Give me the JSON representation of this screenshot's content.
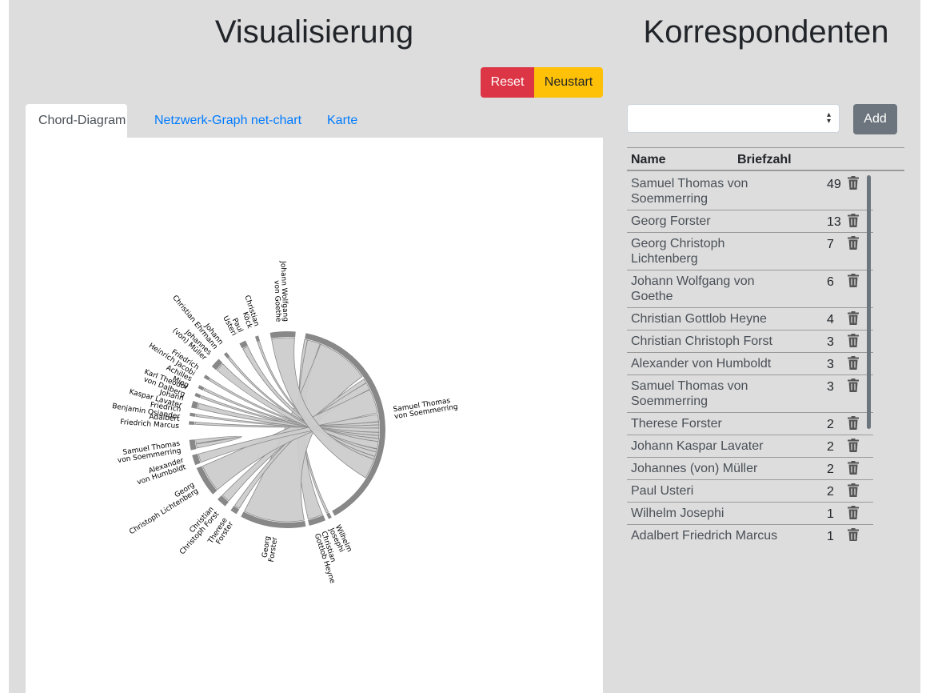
{
  "left_title": "Visualisierung",
  "right_title": "Korrespondenten",
  "buttons": {
    "reset": "Reset",
    "restart": "Neustart",
    "add": "Add"
  },
  "tabs": [
    "Chord-Diagram",
    "Netzwerk-Graph net-chart",
    "Karte"
  ],
  "select": {
    "value": ""
  },
  "table": {
    "headers": {
      "name": "Name",
      "count": "Briefzahl"
    },
    "rows": [
      {
        "name": "Samuel Thomas von Soemmerring",
        "count": "49"
      },
      {
        "name": "Georg Forster",
        "count": "13"
      },
      {
        "name": "Georg Christoph Lichtenberg",
        "count": "7"
      },
      {
        "name": "Johann Wolfgang von Goethe",
        "count": "6"
      },
      {
        "name": "Christian Gottlob Heyne",
        "count": "4"
      },
      {
        "name": "Christian Christoph Forst",
        "count": "3"
      },
      {
        "name": "Alexander von Humboldt",
        "count": "3"
      },
      {
        "name": "Samuel Thomas von Soemmerring",
        "count": "3"
      },
      {
        "name": "Therese Forster",
        "count": "2"
      },
      {
        "name": "Johann Kaspar Lavater",
        "count": "2"
      },
      {
        "name": "Johannes (von) Müller",
        "count": "2"
      },
      {
        "name": "Paul Usteri",
        "count": "2"
      },
      {
        "name": "Wilhelm Josephi",
        "count": "1"
      },
      {
        "name": "Adalbert Friedrich Marcus",
        "count": "1"
      }
    ]
  },
  "chord": {
    "groups": [
      {
        "lines": [
          "Samuel Thomas",
          "von Soemmerring"
        ]
      },
      {
        "lines": [
          "Wilhelm",
          "Josephi"
        ]
      },
      {
        "lines": [
          "Christian",
          "Gottlob Heyne"
        ]
      },
      {
        "lines": [
          "Georg",
          "Forster"
        ]
      },
      {
        "lines": [
          "Therese",
          "Forster"
        ]
      },
      {
        "lines": [
          "Christian",
          "Christoph Forst"
        ]
      },
      {
        "lines": [
          "Georg",
          "Christoph Lichtenberg"
        ]
      },
      {
        "lines": [
          "Alexander",
          "von Humboldt"
        ]
      },
      {
        "lines": [
          "Samuel Thomas",
          "von Soemmerring"
        ]
      },
      {
        "lines": [
          "Adalbert",
          "Friedrich Marcus"
        ]
      },
      {
        "lines": [
          "Friedrich",
          "Benjamin Osiander"
        ]
      },
      {
        "lines": [
          "Johann",
          "Kaspar Lavater"
        ]
      },
      {
        "lines": [
          "Karl Theodor",
          "von Dalberg"
        ]
      },
      {
        "lines": [
          "Achilles",
          "Mieg"
        ]
      },
      {
        "lines": [
          "Friedrich",
          "Heinrich Jacobi"
        ]
      },
      {
        "lines": [
          "Johannes",
          "(von) Müller"
        ]
      },
      {
        "lines": [
          "Johann",
          "Christian Ehrmann"
        ]
      },
      {
        "lines": [
          "Paul",
          "Usteri"
        ]
      },
      {
        "lines": [
          "Christian",
          "Köck"
        ]
      },
      {
        "lines": [
          "Johann Wolfgang",
          "von Goethe"
        ]
      }
    ]
  }
}
